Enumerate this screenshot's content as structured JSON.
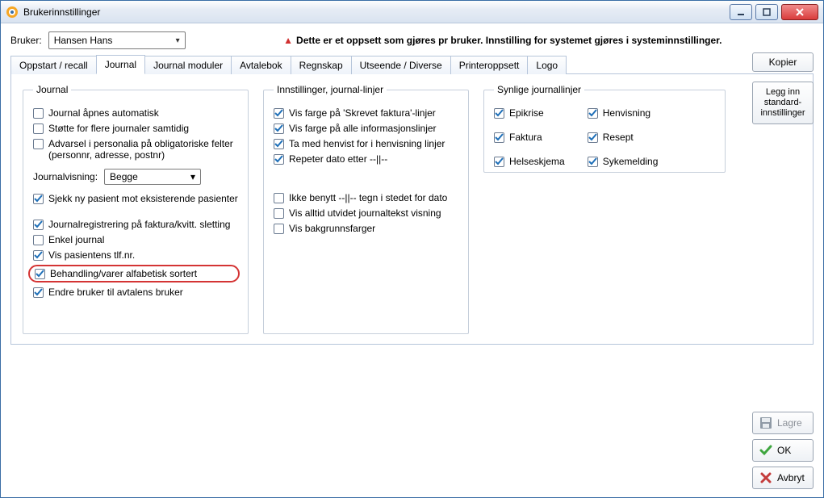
{
  "window": {
    "title": "Brukerinnstillinger"
  },
  "top": {
    "user_label": "Bruker:",
    "user_value": "Hansen Hans",
    "warning": "Dette er et oppsett som gjøres pr bruker. Innstilling for systemet gjøres i systeminnstillinger.",
    "kopier": "Kopier"
  },
  "tabs": {
    "oppstart": "Oppstart / recall",
    "journal": "Journal",
    "journal_moduler": "Journal moduler",
    "avtalebok": "Avtalebok",
    "regnskap": "Regnskap",
    "utseende": "Utseende / Diverse",
    "printer": "Printeroppsett",
    "logo": "Logo"
  },
  "groups": {
    "journal_title": "Journal",
    "settings_title": "Innstillinger, journal-linjer",
    "visible_title": "Synlige journallinjer"
  },
  "journal": {
    "auto_open": "Journal åpnes automatisk",
    "multi": "Støtte for flere journaler samtidig",
    "advarsel": "Advarsel i personalia på obligatoriske  felter  (personnr, adresse, postnr)",
    "jv_label": "Journalvisning:",
    "jv_value": "Begge",
    "sjekk": "Sjekk ny pasient mot eksisterende pasienter",
    "reg": "Journalregistrering på faktura/kvitt. sletting",
    "enkel": "Enkel journal",
    "tlf": "Vis pasientens tlf.nr.",
    "alfa": "Behandling/varer alfabetisk sortert",
    "endre": "Endre bruker til avtalens bruker"
  },
  "settings": {
    "farge_faktura": "Vis farge på 'Skrevet faktura'-linjer",
    "farge_info": "Vis farge på alle informasjonslinjer",
    "henvist": "Ta med henvist for i henvisning linjer",
    "repeter": "Repeter dato etter --||--",
    "ikke_benytt": "Ikke benytt --||-- tegn i stedet for dato",
    "utvidet": "Vis alltid utvidet journaltekst visning",
    "bakgrunn": "Vis bakgrunnsfarger"
  },
  "visible": {
    "epikrise": "Epikrise",
    "faktura": "Faktura",
    "helseskjema": "Helseskjema",
    "henvisning": "Henvisning",
    "resept": "Resept",
    "sykemelding": "Sykemelding"
  },
  "side": {
    "legginn": "Legg inn standard-innstillinger"
  },
  "footer": {
    "lagre": "Lagre",
    "ok": "OK",
    "avbryt": "Avbryt"
  }
}
